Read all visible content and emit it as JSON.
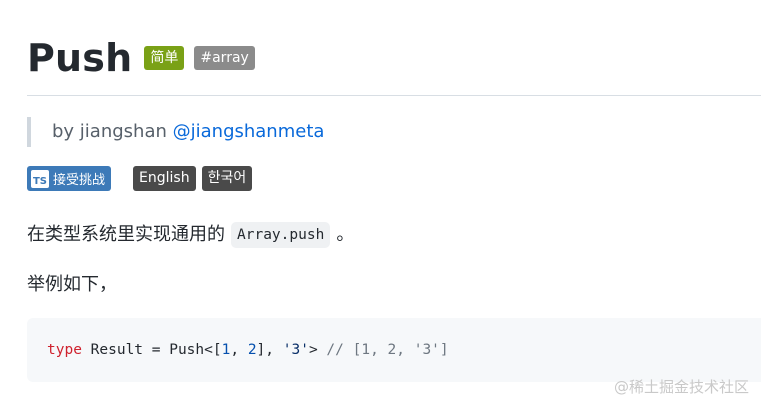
{
  "header": {
    "title": "Push",
    "difficulty": "简单",
    "tag": "#array"
  },
  "author": {
    "prefix": "by jiangshan",
    "handle": "@jiangshanmeta"
  },
  "badges": {
    "ts_icon": "TS",
    "challenge": "接受挑战",
    "lang_en": "English",
    "lang_ko": "한국어",
    "challenge_color": "#3d7ab8",
    "easy_color": "#7aa116"
  },
  "description": {
    "text_before": "在类型系统里实现通用的",
    "code": "Array.push",
    "text_after": "。",
    "example_intro": "举例如下，"
  },
  "code_block": {
    "keyword": "type",
    "rest1": " Result = Push<[",
    "n1": "1",
    "comma1": ", ",
    "n2": "2",
    "rest2": "], ",
    "str": "'3'",
    "rest3": "> ",
    "comment": "// [1, 2, '3']"
  },
  "watermark": "@稀土掘金技术社区"
}
